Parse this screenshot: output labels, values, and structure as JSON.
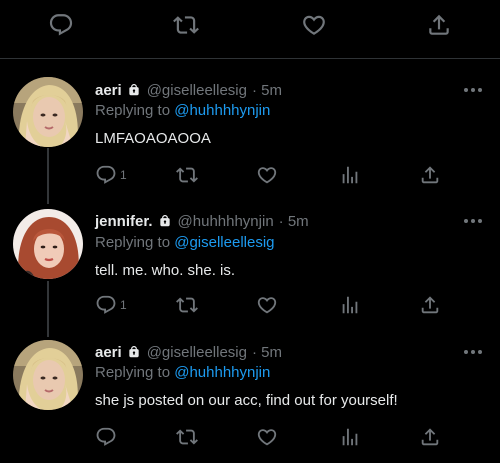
{
  "top_actions": [
    "reply-icon",
    "retweet-icon",
    "like-icon",
    "share-icon"
  ],
  "tweets": [
    {
      "name": "aeri",
      "handle": "@giselleellesig",
      "time": "· 5m",
      "replying_label": "Replying to",
      "replying_to": "@huhhhhynjin",
      "text": "LMFAOAOAOOA",
      "reply_count": "1"
    },
    {
      "name": "jennifer.",
      "handle": "@huhhhhynjin",
      "time": "· 5m",
      "replying_label": "Replying to",
      "replying_to": "@giselleellesig",
      "text": "tell. me. who. she. is.",
      "reply_count": "1"
    },
    {
      "name": "aeri",
      "handle": "@giselleellesig",
      "time": "· 5m",
      "replying_label": "Replying to",
      "replying_to": "@huhhhhynjin",
      "text": "she js posted on our acc, find out for yourself!",
      "reply_count": ""
    }
  ],
  "colors": {
    "background": "#000000",
    "text": "#e7e9ea",
    "muted": "#71767b",
    "link": "#1d9bf0",
    "divider": "#2f3336"
  }
}
